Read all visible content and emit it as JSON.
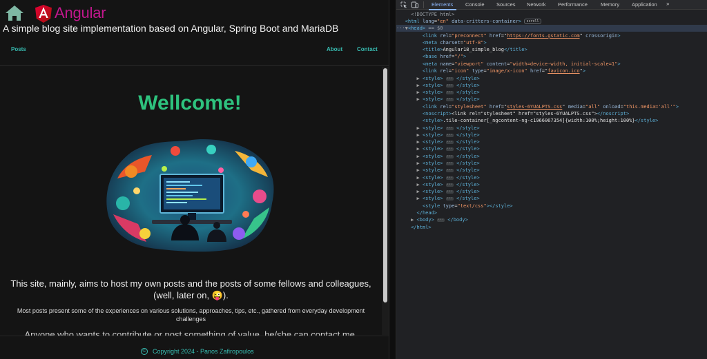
{
  "site": {
    "brand": "Angular",
    "subtitle": "A simple blog site implementation based on Angular, Spring Boot and MariaDB",
    "nav": {
      "posts": "Posts",
      "about": "About",
      "contact": "Contact"
    },
    "welcome": "Wellcome!",
    "intro_1": "This site, mainly, aims to host my own posts and the posts of some fellows and colleagues, (well, later on, 😜).",
    "intro_2": "Most posts present some of the experiences on various solutions, approaches, tips, etc., gathered from everyday development challenges",
    "intro_3": "Anyone who wants to contribute or post something of value, he/she can contact me.",
    "footer": "Copyright 2024 - Panos Zafiropoulos",
    "copyright_symbol": "©",
    "colors": {
      "brand": "#c2178d",
      "welcome": "#2ec27e",
      "link": "#38bdb2"
    }
  },
  "devtools": {
    "tabs": [
      "Elements",
      "Console",
      "Sources",
      "Network",
      "Performance",
      "Memory",
      "Application"
    ],
    "active_tab": "Elements",
    "more": "»",
    "icons": [
      "inspect-element-icon",
      "device-toolbar-icon",
      "more-tabs-icon"
    ],
    "dom": {
      "doctype": "<!DOCTYPE html>",
      "html_open": {
        "tag": "<html",
        "a1": "lang",
        "v1": "\"en\"",
        "a2": "data-critters-container",
        "end": ">",
        "badge": "scroll"
      },
      "head_open": {
        "prefix": "···▼",
        "tag": "<head>",
        "eq": " == $0"
      },
      "link_preconnect": {
        "tag": "<link",
        "a1": "rel",
        "v1": "\"preconnect\"",
        "a2": "href",
        "v2": "https://fonts.gstatic.com",
        "a3": "crossorigin",
        "end": ">"
      },
      "meta_charset": {
        "tag": "<meta",
        "a1": "charset",
        "v1": "\"utf-8\"",
        "end": ">"
      },
      "title": {
        "open": "<title>",
        "text": "Angular18_simple_blog",
        "close": "</title>"
      },
      "base": {
        "tag": "<base",
        "a1": "href",
        "v1": "\"/\"",
        "end": ">"
      },
      "meta_viewport": {
        "tag": "<meta",
        "a1": "name",
        "v1": "\"viewport\"",
        "a2": "content",
        "v2": "\"width=device-width, initial-scale=1\"",
        "end": ">"
      },
      "link_icon": {
        "tag": "<link",
        "a1": "rel",
        "v1": "\"icon\"",
        "a2": "type",
        "v2": "\"image/x-icon\"",
        "a3": "href",
        "v3": "favicon.ico",
        "end": ">"
      },
      "style_open": "<style>",
      "style_ellipsis": "···",
      "style_close": "</style>",
      "link_styles": {
        "tag": "<link",
        "a1": "rel",
        "v1": "\"stylesheet\"",
        "a2": "href",
        "v2": "styles-6YUALPTS.css",
        "a3": "media",
        "v3": "\"all\"",
        "a4": "onload",
        "v4": "\"this.media='all'\"",
        "end": ">"
      },
      "noscript": {
        "open": "<noscript>",
        "text": "<link rel=\"stylesheet\" href=\"styles-6YUALPTS.css\">",
        "close": "</noscript>"
      },
      "style_tile": {
        "open": "<style>",
        "text": ".tile-container[_ngcontent-ng-c1966067354]{width:100%;height:100%}",
        "close": "</style>"
      },
      "style_textcss": {
        "tag": "<style",
        "a1": "type",
        "v1": "\"text/css\"",
        "end": "></style>"
      },
      "head_close": "</head>",
      "body": {
        "open": "<body>",
        "close": "</body>"
      },
      "html_close": "</html>"
    }
  }
}
